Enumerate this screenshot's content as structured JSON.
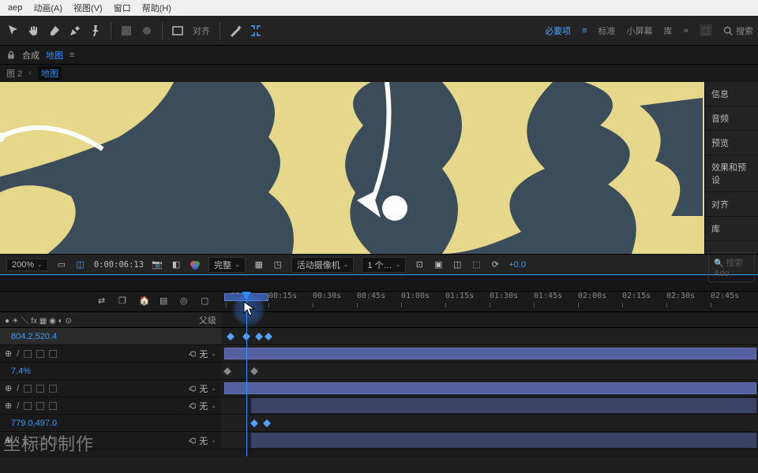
{
  "menubar": {
    "items": [
      "动画(A)",
      "视图(V)",
      "窗口",
      "帮助(H)"
    ],
    "title_fragment": "aep"
  },
  "toolbar": {
    "align_label": "对齐",
    "workspaces": {
      "essential": "必要项",
      "standard": "标准",
      "small": "小屏幕",
      "library": "库"
    },
    "search_placeholder": "搜索"
  },
  "comp_header": {
    "label": "合成",
    "name": "地图"
  },
  "tabs": {
    "tab1": "图 2",
    "tab2": "地图"
  },
  "side_panels": [
    "信息",
    "音频",
    "预览",
    "效果和预设",
    "对齐",
    "库"
  ],
  "side_search": "搜索 Ado",
  "view_footer": {
    "zoom": "200%",
    "timecode": "0:00:06:13",
    "quality": "完整",
    "camera": "活动摄像机",
    "views": "1 个…",
    "exposure": "+0.0"
  },
  "timeline": {
    "ticks": [
      ":00s",
      "00:15s",
      "00:30s",
      "00:45s",
      "01:00s",
      "01:15s",
      "01:30s",
      "01:45s",
      "02:00s",
      "02:15s",
      "02:30s",
      "02:45s"
    ],
    "col_icons": "● ☀ ＼ fx ▦ ◉ ◐ ⊙",
    "parent_col": "父级",
    "none": "无",
    "pos_value": "804.2,520.4",
    "opacity_value": "7.4%",
    "coord_value": "779.0,497.0",
    "watermark": "坐标的制作"
  }
}
